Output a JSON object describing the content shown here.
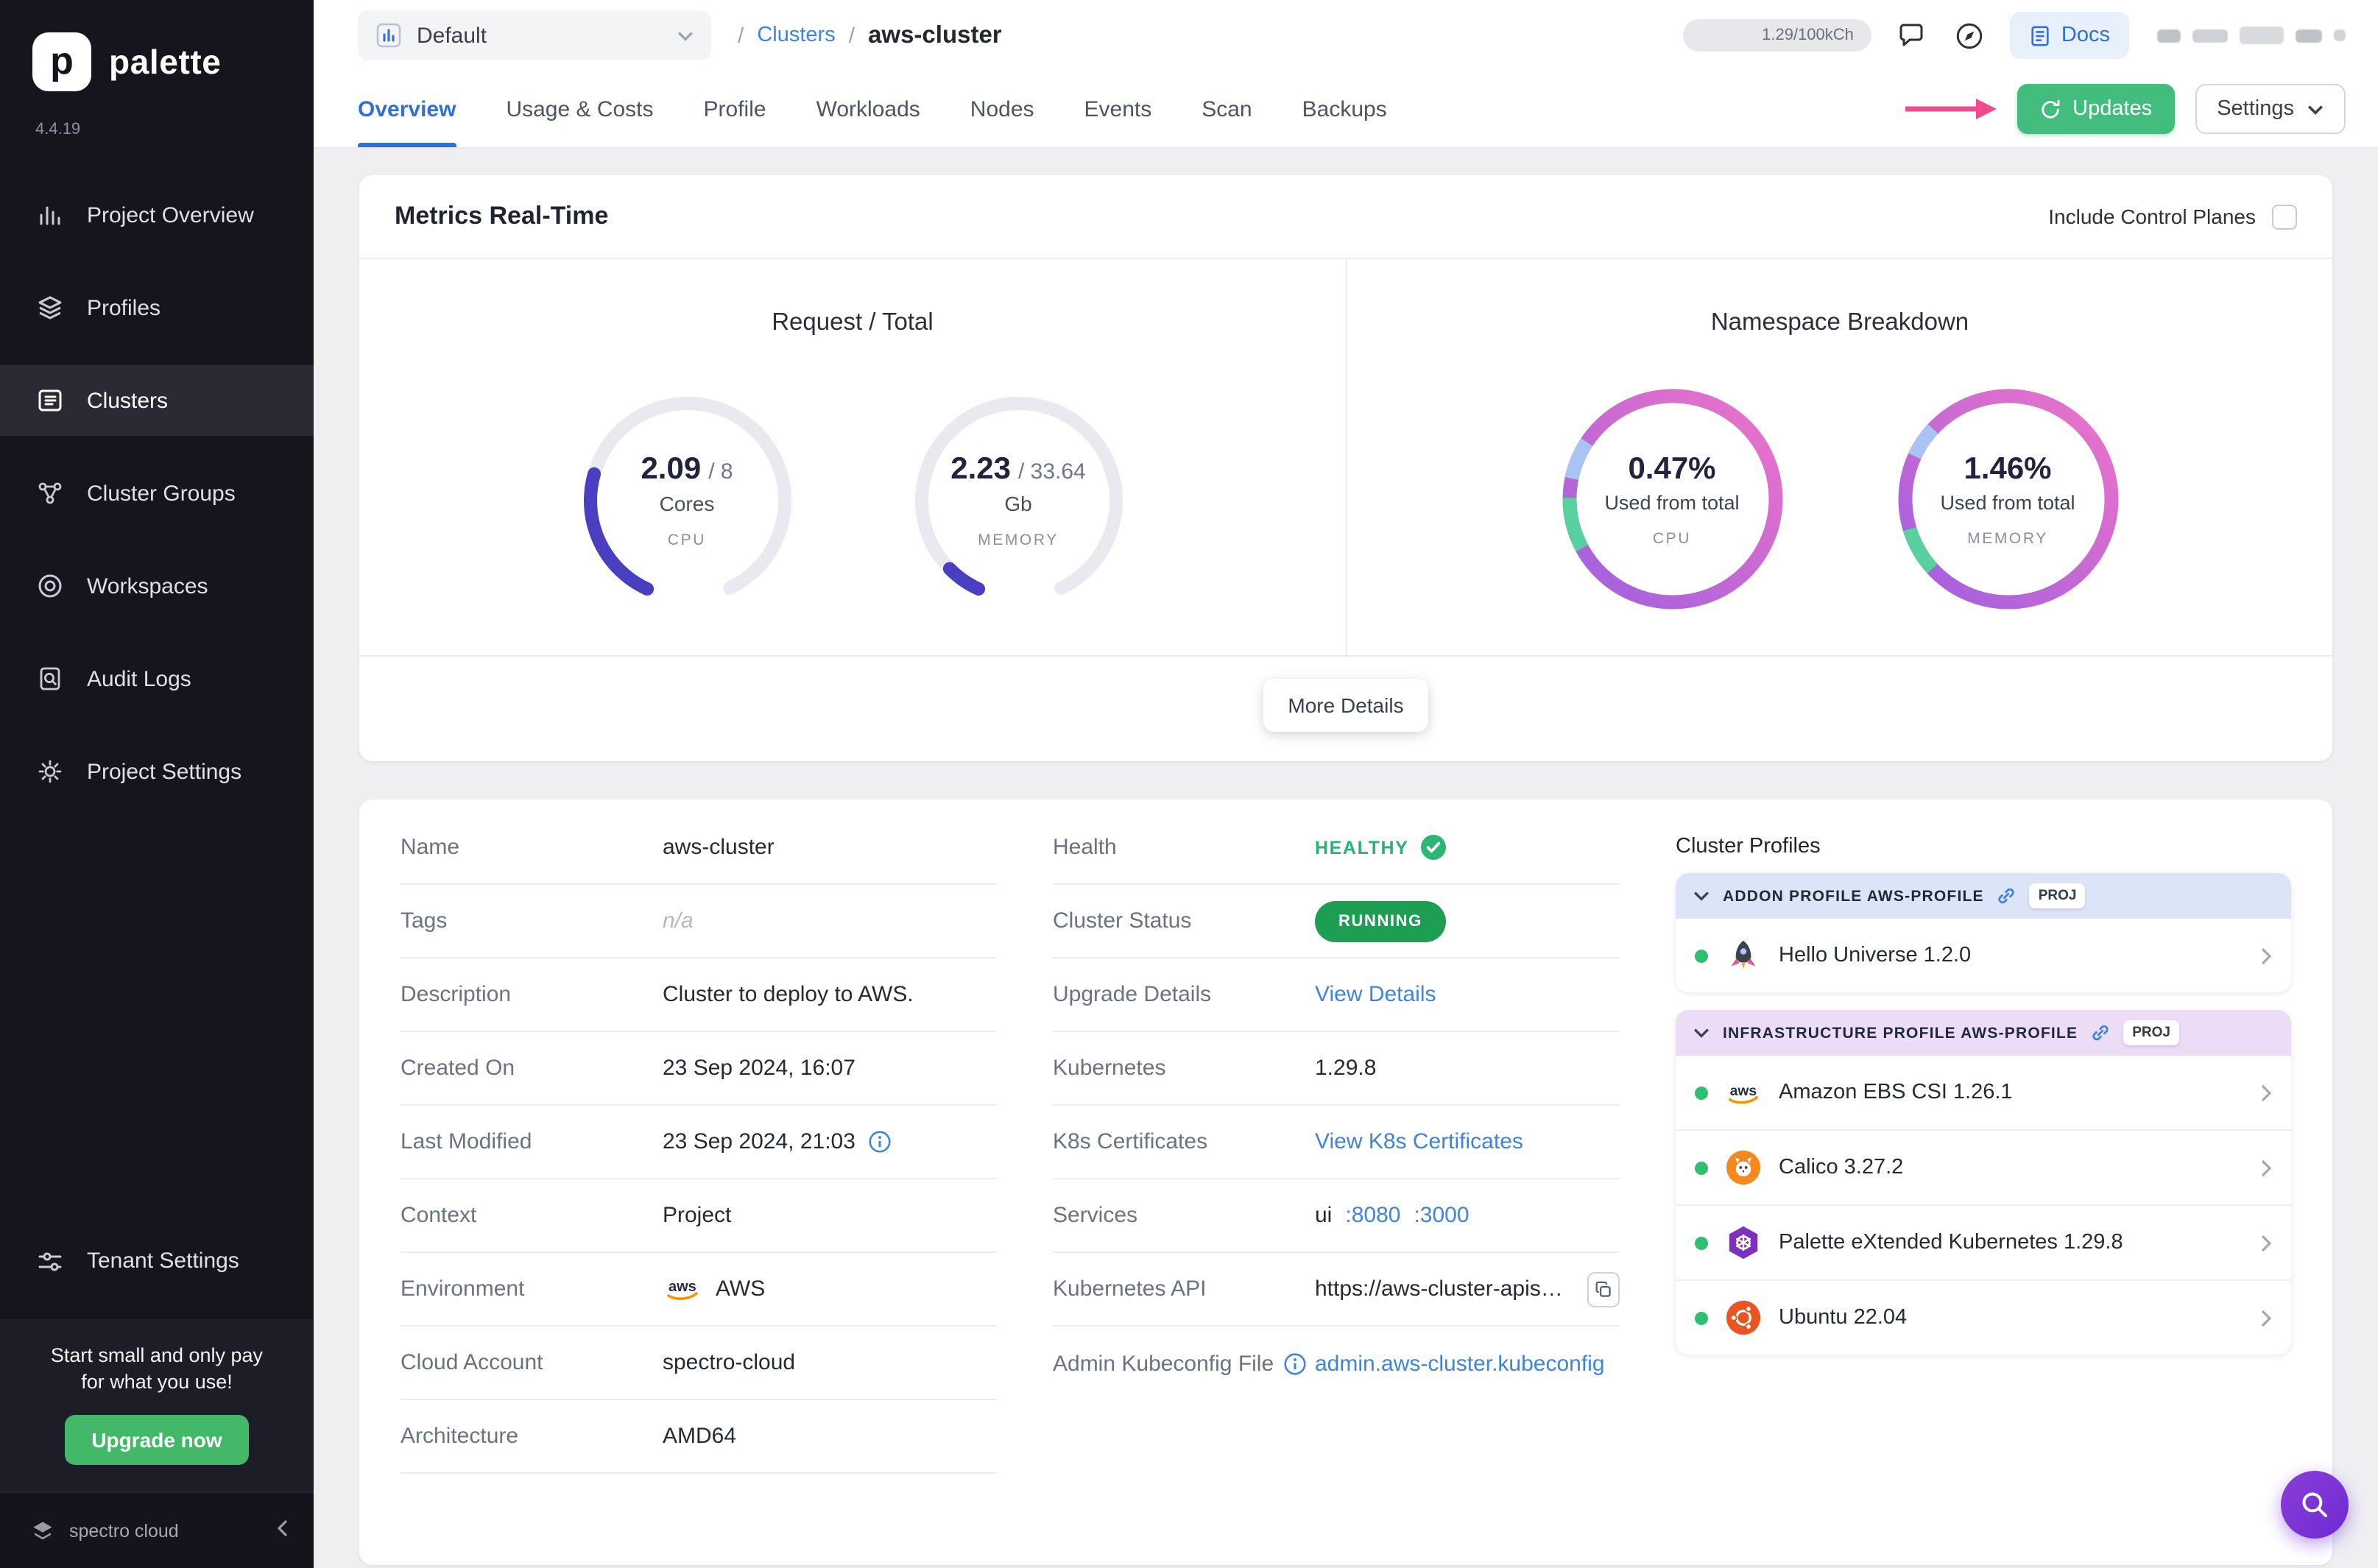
{
  "app": {
    "brand": "palette",
    "logo_letter": "p",
    "version": "4.4.19",
    "footer_brand": "spectro cloud"
  },
  "logos": {
    "aws": "aws"
  },
  "sidebar": {
    "items": [
      {
        "label": "Project Overview",
        "icon": "bar-chart-icon"
      },
      {
        "label": "Profiles",
        "icon": "layers-icon"
      },
      {
        "label": "Clusters",
        "icon": "list-icon",
        "active": true
      },
      {
        "label": "Cluster Groups",
        "icon": "nodes-icon"
      },
      {
        "label": "Workspaces",
        "icon": "target-icon"
      },
      {
        "label": "Audit Logs",
        "icon": "audit-doc-icon"
      },
      {
        "label": "Project Settings",
        "icon": "gear-icon"
      }
    ],
    "tenant_settings_label": "Tenant Settings",
    "promo_text": "Start small and only pay for what you use!",
    "promo_button": "Upgrade now"
  },
  "header": {
    "project_selector_value": "Default",
    "breadcrumb_separator": "/",
    "breadcrumb_parent": "Clusters",
    "breadcrumb_current": "aws-cluster",
    "usage_pill": "1.29/100kCh",
    "docs_button": "Docs"
  },
  "tabs": [
    "Overview",
    "Usage & Costs",
    "Profile",
    "Workloads",
    "Nodes",
    "Events",
    "Scan",
    "Backups"
  ],
  "toolbar": {
    "updates_button": "Updates",
    "settings_button": "Settings"
  },
  "metrics": {
    "title": "Metrics Real-Time",
    "include_control_planes_label": "Include Control Planes",
    "request_total_title": "Request / Total",
    "gauges": [
      {
        "value": "2.09",
        "total": "/ 8",
        "unit": "Cores",
        "label": "CPU"
      },
      {
        "value": "2.23",
        "total": "/ 33.64",
        "unit": "Gb",
        "label": "MEMORY"
      }
    ],
    "namespace_title": "Namespace Breakdown",
    "donuts": [
      {
        "percent": "0.47%",
        "caption": "Used from total",
        "label": "CPU"
      },
      {
        "percent": "1.46%",
        "caption": "Used from total",
        "label": "MEMORY"
      }
    ],
    "more_details_button": "More Details"
  },
  "overview": {
    "fields": [
      {
        "label": "Name",
        "value": "aws-cluster"
      },
      {
        "label": "Tags",
        "value": "n/a"
      },
      {
        "label": "Description",
        "value": "Cluster to deploy to AWS."
      },
      {
        "label": "Created On",
        "value": "23 Sep 2024, 16:07"
      },
      {
        "label": "Last Modified",
        "value": "23 Sep 2024, 21:03"
      },
      {
        "label": "Context",
        "value": "Project"
      },
      {
        "label": "Environment",
        "value": "AWS"
      },
      {
        "label": "Cloud Account",
        "value": "spectro-cloud"
      },
      {
        "label": "Architecture",
        "value": "AMD64"
      }
    ],
    "status": {
      "health_label": "Health",
      "health_value": "HEALTHY",
      "cluster_status_label": "Cluster Status",
      "cluster_status_value": "RUNNING",
      "upgrade_label": "Upgrade Details",
      "upgrade_link": "View Details",
      "kubernetes_label": "Kubernetes",
      "kubernetes_value": "1.29.8",
      "certificates_label": "K8s Certificates",
      "certificates_link": "View K8s Certificates",
      "services_label": "Services",
      "services_value": "ui",
      "services_ports": [
        ":8080",
        ":3000"
      ],
      "api_label": "Kubernetes API",
      "api_value": "https://aws-cluster-apiserve...",
      "kubeconfig_label": "Admin Kubeconfig File",
      "kubeconfig_link": "admin.aws-cluster.kubeconfig"
    }
  },
  "cluster_profiles": {
    "title": "Cluster Profiles",
    "proj_badge": "PROJ",
    "sections": [
      {
        "title": "ADDON PROFILE AWS-PROFILE",
        "items": [
          {
            "name": "Hello Universe 1.2.0",
            "icon": "rocket-icon"
          }
        ]
      },
      {
        "title": "INFRASTRUCTURE PROFILE AWS-PROFILE",
        "items": [
          {
            "name": "Amazon EBS CSI 1.26.1",
            "icon": "aws-icon"
          },
          {
            "name": "Calico 3.27.2",
            "icon": "calico-icon"
          },
          {
            "name": "Palette eXtended Kubernetes 1.29.8",
            "icon": "pxk-icon"
          },
          {
            "name": "Ubuntu 22.04",
            "icon": "ubuntu-icon"
          }
        ]
      }
    ]
  }
}
